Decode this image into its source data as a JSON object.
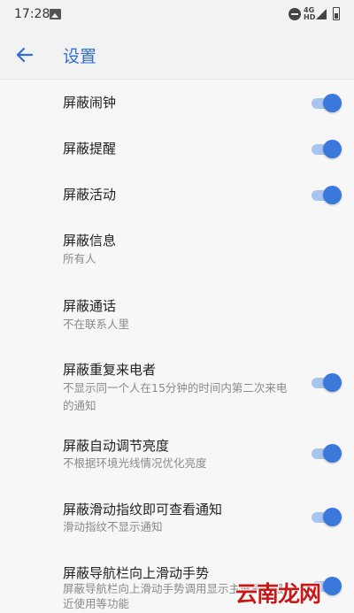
{
  "status_bar": {
    "time": "17:28",
    "network_label": "4G",
    "network_sub": "HD"
  },
  "app_bar": {
    "title": "设置"
  },
  "settings": [
    {
      "title": "屏蔽闹钟",
      "summary": "",
      "toggle_on": true
    },
    {
      "title": "屏蔽提醒",
      "summary": "",
      "toggle_on": true
    },
    {
      "title": "屏蔽活动",
      "summary": "",
      "toggle_on": true
    },
    {
      "title": "屏蔽信息",
      "summary": "所有人"
    },
    {
      "title": "屏蔽通话",
      "summary": "不在联系人里"
    },
    {
      "title": "屏蔽重复来电者",
      "summary": "不显示同一个人在15分钟的时间内第二次来电的通知",
      "toggle_on": true
    },
    {
      "title": "屏蔽自动调节亮度",
      "summary": "不根据环境光线情况优化亮度",
      "toggle_on": true
    },
    {
      "title": "屏蔽滑动指纹即可查看通知",
      "summary": "滑动指纹不显示通知",
      "toggle_on": true
    },
    {
      "title": "屏蔽导航栏向上滑动手势",
      "summary": "屏蔽导航栏向上滑动手势调用显示主屏幕、最近使用等功能",
      "toggle_on": true
    }
  ],
  "watermark": "云南龙网",
  "colors": {
    "accent": "#3a78dc",
    "track": "#a9c4ee",
    "title_blue": "#2f6fd4",
    "background": "#f7f7f7"
  }
}
